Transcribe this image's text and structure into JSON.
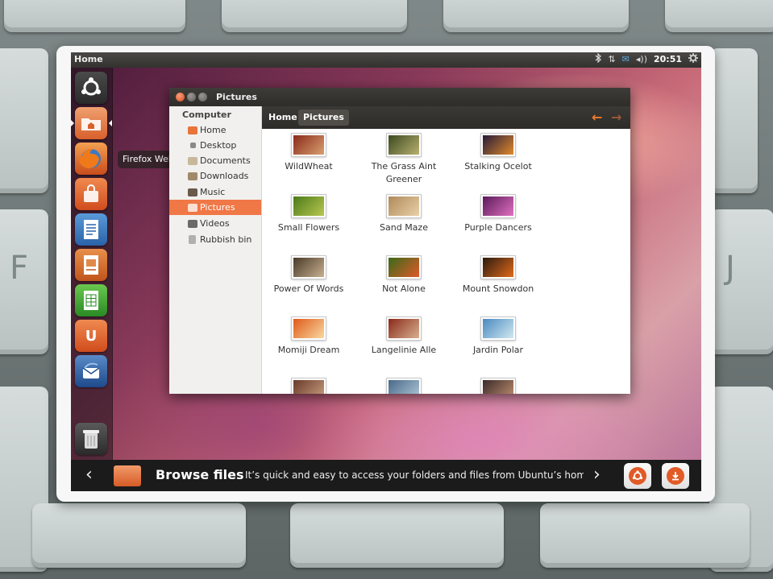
{
  "background": {
    "keyboard_keys": [
      "F",
      "J"
    ]
  },
  "top_panel": {
    "title": "Home",
    "indicators": {
      "bluetooth": "bluetooth-icon",
      "network": "⇅",
      "mail": "✉",
      "volume": "◂))",
      "clock": "20:51",
      "settings": "gear-icon"
    }
  },
  "launcher": {
    "items": [
      {
        "name": "dash-home",
        "icon": "ubuntu-logo-icon"
      },
      {
        "name": "home-folder",
        "icon": "folder-icon"
      },
      {
        "name": "firefox",
        "icon": "firefox-icon"
      },
      {
        "name": "ubuntu-software-centre",
        "icon": "shopping-bag-icon"
      },
      {
        "name": "libreoffice-writer",
        "icon": "document-icon"
      },
      {
        "name": "libreoffice-impress",
        "icon": "presentation-icon"
      },
      {
        "name": "libreoffice-calc",
        "icon": "spreadsheet-icon"
      },
      {
        "name": "ubuntu-one",
        "icon": "ubuntu-one-icon",
        "glyph": "U"
      },
      {
        "name": "thunderbird",
        "icon": "thunderbird-icon"
      },
      {
        "name": "trash",
        "icon": "trash-icon"
      }
    ],
    "tooltip": "Firefox Web Browser"
  },
  "window": {
    "title": "Pictures",
    "sidebar": {
      "heading": "Computer",
      "items": [
        {
          "label": "Home",
          "icon": "home-folder-icon",
          "selected": false
        },
        {
          "label": "Desktop",
          "icon": "desktop-icon",
          "selected": false
        },
        {
          "label": "Documents",
          "icon": "documents-icon",
          "selected": false
        },
        {
          "label": "Downloads",
          "icon": "downloads-icon",
          "selected": false
        },
        {
          "label": "Music",
          "icon": "music-icon",
          "selected": false
        },
        {
          "label": "Pictures",
          "icon": "pictures-icon",
          "selected": true
        },
        {
          "label": "Videos",
          "icon": "videos-icon",
          "selected": false
        },
        {
          "label": "Rubbish bin",
          "icon": "trash-icon",
          "selected": false
        }
      ]
    },
    "breadcrumbs": [
      "Home",
      "Pictures"
    ],
    "back_arrow": "←",
    "forward_arrow": "→",
    "files": [
      {
        "label": "WildWheat",
        "colors": [
          "#8a2a1a",
          "#d8a070"
        ]
      },
      {
        "label": "The Grass Aint Greener",
        "colors": [
          "#3c4a20",
          "#b8b070"
        ]
      },
      {
        "label": "Stalking Ocelot",
        "colors": [
          "#241a3a",
          "#e08a2a"
        ]
      },
      {
        "label": "Small Flowers",
        "colors": [
          "#4c7a1a",
          "#b8c850"
        ]
      },
      {
        "label": "Sand Maze",
        "colors": [
          "#b08a5a",
          "#e8d0a8"
        ]
      },
      {
        "label": "Purple Dancers",
        "colors": [
          "#5a1a5a",
          "#e070c0"
        ]
      },
      {
        "label": "Power Of Words",
        "colors": [
          "#4a3a2a",
          "#c8b090"
        ]
      },
      {
        "label": "Not Alone",
        "colors": [
          "#3a6a1a",
          "#e05a2a"
        ]
      },
      {
        "label": "Mount Snowdon",
        "colors": [
          "#2a1a10",
          "#e06a1a"
        ]
      },
      {
        "label": "Momiji Dream",
        "colors": [
          "#e05a1a",
          "#f8d8a0"
        ]
      },
      {
        "label": "Langelinie Alle",
        "colors": [
          "#8a2a1a",
          "#d8b090"
        ]
      },
      {
        "label": "Jardin Polar",
        "colors": [
          "#4a8ac0",
          "#d0e8f0"
        ]
      },
      {
        "label": "",
        "colors": [
          "#6a3a2a",
          "#c8a080"
        ]
      },
      {
        "label": "",
        "colors": [
          "#4a6a8a",
          "#b0c8d8"
        ]
      },
      {
        "label": "",
        "colors": [
          "#3a2a2a",
          "#c09070"
        ]
      }
    ]
  },
  "banner": {
    "prev": "‹",
    "next": "›",
    "heading": "Browse files",
    "description": "It’s quick and easy to access your folders and files from Ubuntu’s home folder.",
    "buttons": [
      {
        "name": "ubuntu-logo-button",
        "icon": "ubuntu-logo-icon"
      },
      {
        "name": "download-button",
        "icon": "download-icon"
      }
    ]
  }
}
